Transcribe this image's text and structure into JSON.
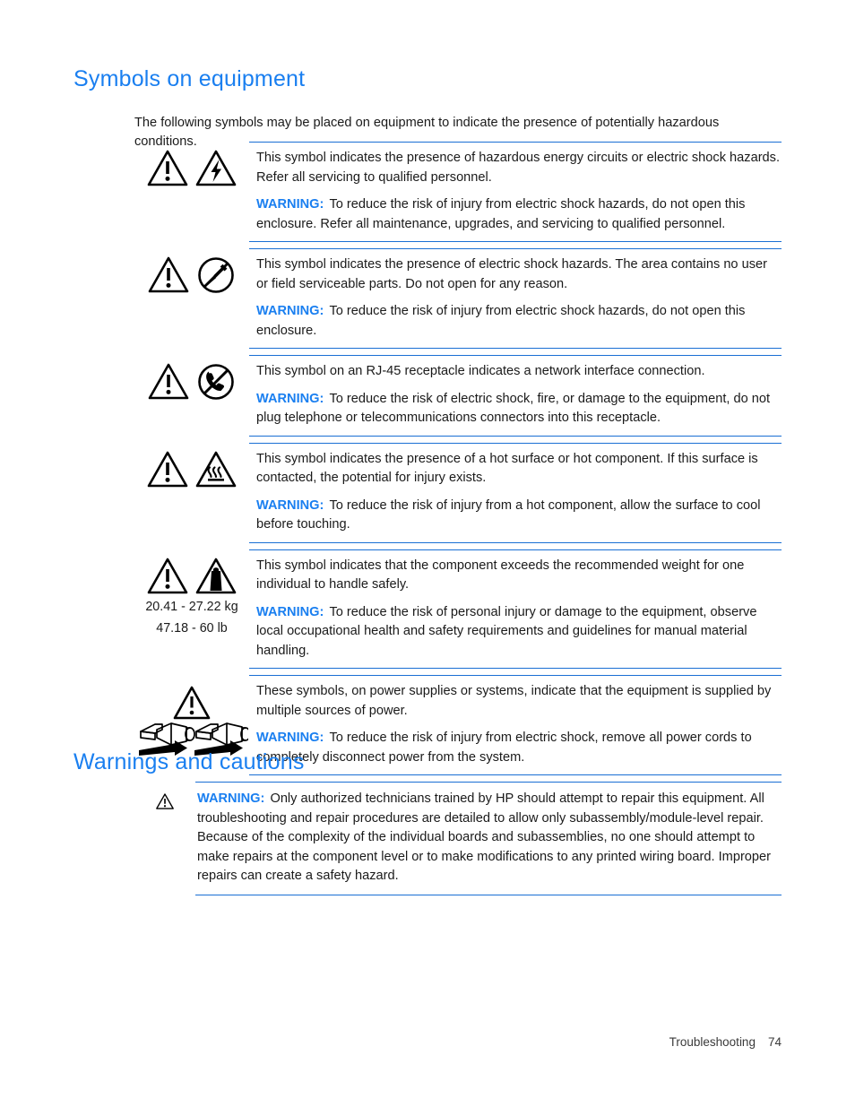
{
  "headings": {
    "symbols": "Symbols on equipment",
    "warnings": "Warnings and cautions"
  },
  "intro": "The following symbols may be placed on equipment to indicate the presence of potentially hazardous conditions.",
  "warning_label": "WARNING:",
  "symbol_rows": [
    {
      "icons": [
        "warning-triangle-icon",
        "electric-shock-triangle-icon"
      ],
      "description": "This symbol indicates the presence of hazardous energy circuits or electric shock hazards. Refer all servicing to qualified personnel.",
      "warning": "To reduce the risk of injury from electric shock hazards, do not open this enclosure. Refer all maintenance, upgrades, and servicing to qualified personnel."
    },
    {
      "icons": [
        "warning-triangle-icon",
        "no-serviceable-parts-icon"
      ],
      "description": "This symbol indicates the presence of electric shock hazards. The area contains no user or field serviceable parts. Do not open for any reason.",
      "warning": "To reduce the risk of injury from electric shock hazards, do not open this enclosure."
    },
    {
      "icons": [
        "warning-triangle-icon",
        "no-telephone-icon"
      ],
      "description": "This symbol on an RJ-45 receptacle indicates a network interface connection.",
      "warning": "To reduce the risk of electric shock, fire, or damage to the equipment, do not plug telephone or telecommunications connectors into this receptacle."
    },
    {
      "icons": [
        "warning-triangle-icon",
        "hot-surface-triangle-icon"
      ],
      "description": "This symbol indicates the presence of a hot surface or hot component. If this surface is contacted, the potential for injury exists.",
      "warning": "To reduce the risk of injury from a hot component, allow the surface to cool before touching."
    },
    {
      "icons": [
        "warning-triangle-icon",
        "heavy-weight-triangle-icon"
      ],
      "weight_metric": "20.41 - 27.22 kg",
      "weight_imperial": "47.18 - 60 lb",
      "description": "This symbol indicates that the component exceeds the recommended weight for one individual to handle safely.",
      "warning": "To reduce the risk of personal injury or damage to the equipment, observe local occupational health and safety requirements and guidelines for manual material handling."
    },
    {
      "icons": [
        "warning-triangle-icon",
        "multiple-power-cords-icon"
      ],
      "description": "These symbols, on power supplies or systems, indicate that the equipment is supplied by multiple sources of power.",
      "warning": "To reduce the risk of injury from electric shock, remove all power cords to completely disconnect power from the system."
    }
  ],
  "bottom_warning": {
    "icon": "warning-triangle-icon",
    "text": "Only authorized technicians trained by HP should attempt to repair this equipment. All troubleshooting and repair procedures are detailed to allow only subassembly/module-level repair. Because of the complexity of the individual boards and subassemblies, no one should attempt to make repairs at the component level or to make modifications to any printed wiring board. Improper repairs can create a safety hazard."
  },
  "footer": {
    "chapter": "Troubleshooting",
    "page_number": "74"
  },
  "colors": {
    "heading_blue": "#1a7ff0",
    "rule_blue": "#1a6fd4",
    "body_text": "#1a1a1a"
  }
}
